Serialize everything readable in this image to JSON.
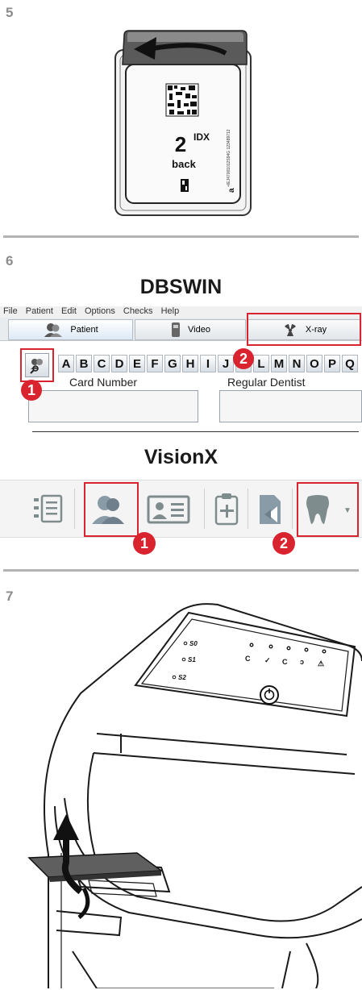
{
  "steps": [
    "5",
    "6",
    "7"
  ],
  "plate": {
    "number": "2",
    "size": "IDX",
    "side": "back",
    "serial": "+IEJ47001012S94G 123489712"
  },
  "dbswin": {
    "title": "DBSWIN",
    "menu": [
      "File",
      "Patient",
      "Edit",
      "Options",
      "Checks",
      "Help"
    ],
    "tabs": [
      "Patient",
      "Video",
      "X-ray"
    ],
    "letters": [
      "A",
      "B",
      "C",
      "D",
      "E",
      "F",
      "G",
      "H",
      "I",
      "J",
      "K",
      "L",
      "M",
      "N",
      "O",
      "P",
      "Q"
    ],
    "fields": [
      "Card Number",
      "Regular Dentist"
    ]
  },
  "visionx": {
    "title": "VisionX"
  },
  "badges": [
    "1",
    "2"
  ],
  "scanner": {
    "labels": [
      "S0",
      "S1",
      "S2"
    ]
  },
  "colors": {
    "highlight": "#d9232e",
    "separator": "#b3b3b3",
    "step": "#8c8c8c"
  }
}
